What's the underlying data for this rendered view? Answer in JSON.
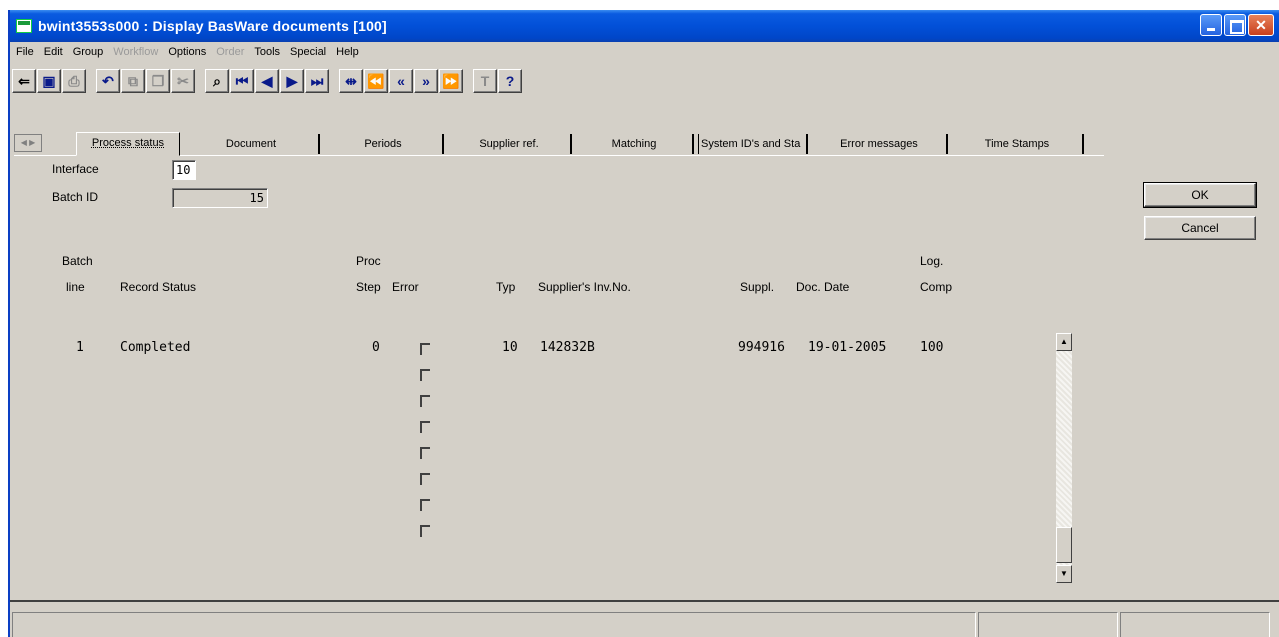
{
  "window": {
    "title": "bwint3553s000 : Display BasWare documents [100]"
  },
  "menu": [
    {
      "label": "File",
      "disabled": false
    },
    {
      "label": "Edit",
      "disabled": false
    },
    {
      "label": "Group",
      "disabled": false
    },
    {
      "label": "Workflow",
      "disabled": true
    },
    {
      "label": "Options",
      "disabled": false
    },
    {
      "label": "Order",
      "disabled": true
    },
    {
      "label": "Tools",
      "disabled": false
    },
    {
      "label": "Special",
      "disabled": false
    },
    {
      "label": "Help",
      "disabled": false
    }
  ],
  "toolbar": {
    "icons": [
      "exit-icon",
      "save-icon",
      "print-icon",
      "undo-icon",
      "paste-icon",
      "copy-icon",
      "cut-icon",
      "find-icon",
      "first-record-icon",
      "previous-record-icon",
      "next-record-icon",
      "last-record-icon",
      "first-set-icon",
      "first-group-icon",
      "previous-group-icon",
      "next-group-icon",
      "last-group-icon",
      "text-icon",
      "whats-this-help-icon"
    ]
  },
  "tabs": [
    {
      "label": "Process status",
      "active": true
    },
    {
      "label": "Document",
      "active": false
    },
    {
      "label": "Periods",
      "active": false
    },
    {
      "label": "Supplier ref.",
      "active": false
    },
    {
      "label": "Matching",
      "active": false
    },
    {
      "label": "System ID's and Sta",
      "active": false
    },
    {
      "label": "Error messages",
      "active": false
    },
    {
      "label": "Time Stamps",
      "active": false
    }
  ],
  "form": {
    "interface_label": "Interface",
    "interface_value": "10",
    "batch_id_label": "Batch ID",
    "batch_id_value": "15"
  },
  "buttons": {
    "ok": "OK",
    "cancel": "Cancel"
  },
  "grid": {
    "headers": {
      "batch_line_1": "Batch",
      "batch_line_2": "line",
      "record_status": "Record Status",
      "proc_step_1": "Proc",
      "proc_step_2": "Step",
      "error": "Error",
      "typ": "Typ",
      "suppliers_inv_no": "Supplier's Inv.No.",
      "suppl": "Suppl.",
      "doc_date": "Doc. Date",
      "log_comp_1": "Log.",
      "log_comp_2": "Comp"
    },
    "rows": [
      {
        "batch_line": "1",
        "record_status": "Completed",
        "proc_step": "0",
        "error": false,
        "typ": "10",
        "suppliers_inv_no": "142832B",
        "suppl": "994916",
        "doc_date": "19-01-2005",
        "log_comp": "100"
      }
    ],
    "empty_error_checkboxes": 7
  }
}
